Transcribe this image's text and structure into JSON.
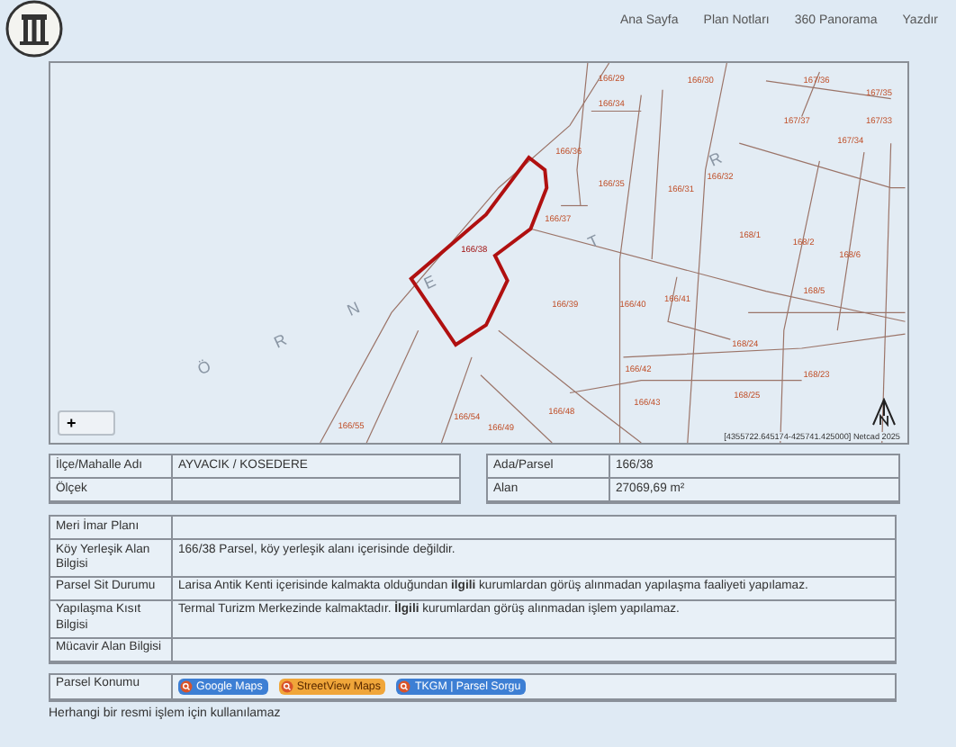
{
  "header": {
    "nav": [
      {
        "label": "Ana Sayfa"
      },
      {
        "label": "Plan Notları"
      },
      {
        "label": "360 Panorama"
      },
      {
        "label": "Yazdır"
      }
    ]
  },
  "map": {
    "parcels": [
      {
        "label": "166/29",
        "highlighted": false
      },
      {
        "label": "166/30",
        "highlighted": false
      },
      {
        "label": "167/36",
        "highlighted": false
      },
      {
        "label": "167/35",
        "highlighted": false
      },
      {
        "label": "166/34",
        "highlighted": false
      },
      {
        "label": "167/37",
        "highlighted": false
      },
      {
        "label": "167/33",
        "highlighted": false
      },
      {
        "label": "166/36",
        "highlighted": false
      },
      {
        "label": "167/34",
        "highlighted": false
      },
      {
        "label": "166/35",
        "highlighted": false
      },
      {
        "label": "166/31",
        "highlighted": false
      },
      {
        "label": "166/32",
        "highlighted": false
      },
      {
        "label": "166/37",
        "highlighted": false
      },
      {
        "label": "166/38",
        "highlighted": true
      },
      {
        "label": "168/1",
        "highlighted": false
      },
      {
        "label": "168/2",
        "highlighted": false
      },
      {
        "label": "168/6",
        "highlighted": false
      },
      {
        "label": "166/39",
        "highlighted": false
      },
      {
        "label": "166/40",
        "highlighted": false
      },
      {
        "label": "166/41",
        "highlighted": false
      },
      {
        "label": "168/5",
        "highlighted": false
      },
      {
        "label": "168/24",
        "highlighted": false
      },
      {
        "label": "166/42",
        "highlighted": false
      },
      {
        "label": "168/23",
        "highlighted": false
      },
      {
        "label": "166/43",
        "highlighted": false
      },
      {
        "label": "168/25",
        "highlighted": false
      },
      {
        "label": "166/55",
        "highlighted": false
      },
      {
        "label": "166/54",
        "highlighted": false
      },
      {
        "label": "166/48",
        "highlighted": false
      },
      {
        "label": "166/49",
        "highlighted": false
      }
    ],
    "place_letters": [
      "Ö",
      "R",
      "N",
      "E",
      "T",
      "R"
    ],
    "zoom_button": "+",
    "attribution": "[4355722.645174-425741.425000] Netcad 2025"
  },
  "summary_left": [
    {
      "label": "İlçe/Mahalle Adı",
      "value": "AYVACIK / KOSEDERE"
    },
    {
      "label": "Ölçek"
    }
  ],
  "summary_right": [
    {
      "label": "Ada/Parsel",
      "value": "166/38"
    },
    {
      "label": "Alan",
      "value": "27069,69 m²"
    }
  ],
  "details": [
    {
      "label": "Meri İmar Planı"
    },
    {
      "label": "Köy Yerleşik Alan Bilgisi",
      "value": "166/38 Parsel, köy yerleşik alanı içerisinde değildir."
    },
    {
      "label": "Parsel Sit Durumu",
      "value": "Larisa Antik Kenti içerisinde kalmakta olduğundan **ilgili** kurumlardan görüş alınmadan yapılaşma faaliyeti yapılamaz."
    },
    {
      "label": "Yapılaşma Kısıt Bilgisi",
      "value": "Termal Turizm Merkezinde kalmaktadır. **İlgili** kurumlardan görüş alınmadan işlem yapılamaz."
    },
    {
      "label": "Mücavir Alan Bilgisi"
    }
  ],
  "location": {
    "label": "Parsel Konumu",
    "links": [
      {
        "label": "Google Maps",
        "color": "#3d7fd4"
      },
      {
        "label": "StreetView Maps",
        "color": "#f0a63a"
      },
      {
        "label": "TKGM | Parsel Sorgu",
        "color": "#3d7fd4"
      }
    ]
  },
  "footer_note": "Herhangi bir resmi işlem için kullanılamaz"
}
